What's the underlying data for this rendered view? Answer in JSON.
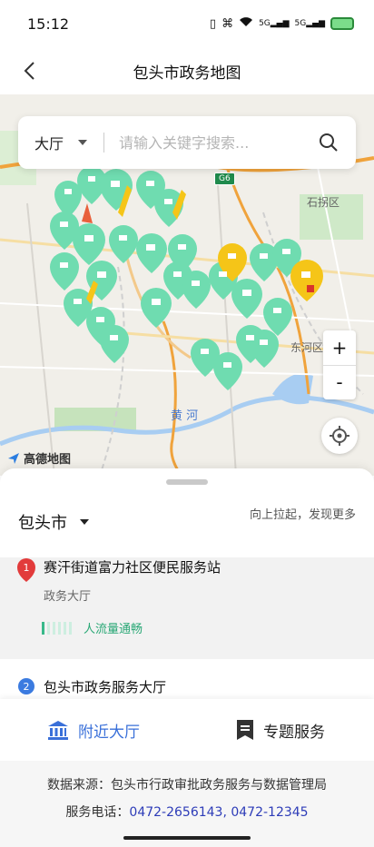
{
  "status_bar": {
    "time": "15:12",
    "signal_1": "5G",
    "signal_2": "5G"
  },
  "header": {
    "title": "包头市政务地图",
    "back_icon": "chevron-left-icon"
  },
  "map": {
    "hall_select": "大厅",
    "search_placeholder": "请输入关键字搜索...",
    "labels": {
      "district_shiguai": "石拐区",
      "district_donghe": "东河区",
      "river": "黄 河",
      "road": "G6"
    },
    "zoom_in": "+",
    "zoom_out": "-",
    "logo": "高德地图",
    "marker_color": "#6fdcb0",
    "highlight_color": "#f5c518"
  },
  "panel": {
    "city": "包头市",
    "pull_hint": "向上拉起，发现更多",
    "results": [
      {
        "rank": "1",
        "name": "赛汗街道富力社区便民服务站",
        "type": "政务大厅",
        "crowd": "人流量通畅"
      },
      {
        "rank": "2",
        "name": "包头市政务服务大厅"
      }
    ]
  },
  "tabs": [
    {
      "label": "附近大厅",
      "icon": "government-building-icon"
    },
    {
      "label": "专题服务",
      "icon": "document-icon"
    }
  ],
  "footer": {
    "source": "数据来源：包头市行政审批政务服务与数据管理局",
    "phone_label": "服务电话：",
    "phone_numbers": "0472-2656143, 0472-12345"
  }
}
